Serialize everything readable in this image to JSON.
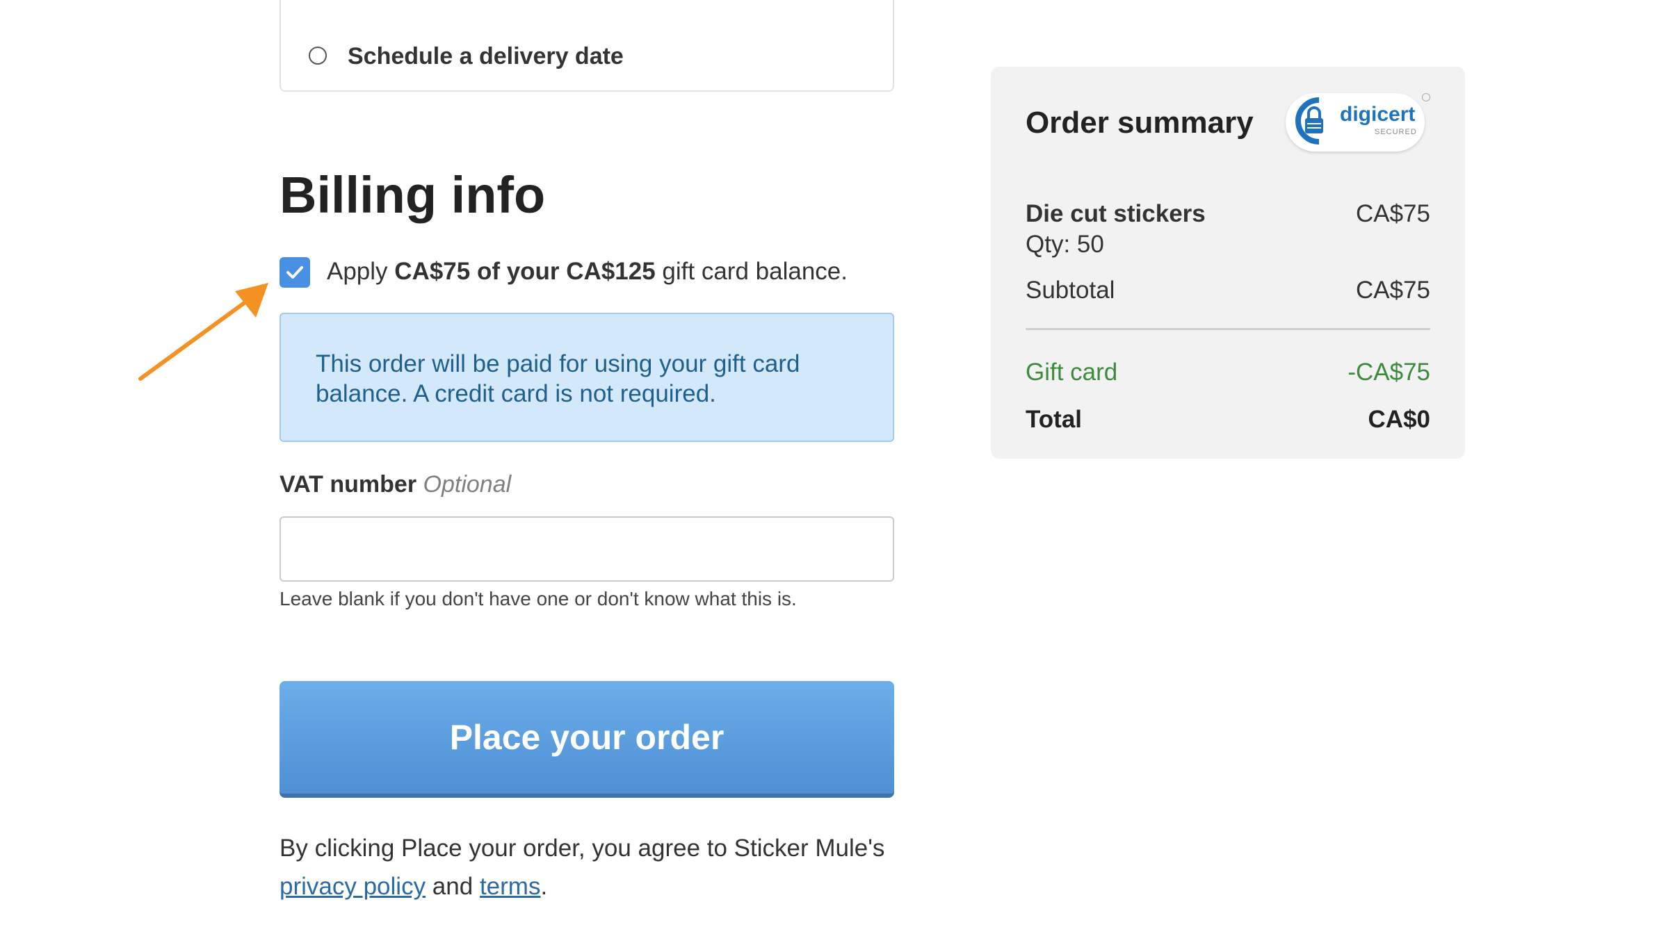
{
  "delivery": {
    "option_label": "Schedule a delivery date"
  },
  "billing": {
    "title": "Billing info",
    "gift_card": {
      "checked": true,
      "prefix": "Apply ",
      "amount_text": "CA$75 of your CA$125",
      "suffix": " gift card balance."
    },
    "notice": "This order will be paid for using your gift card balance. A credit card is not required.",
    "vat": {
      "label": "VAT number",
      "optional": "Optional",
      "value": "",
      "help": "Leave blank if you don't have one or don't know what this is."
    },
    "place_order_label": "Place your order",
    "agree": {
      "text": "By clicking Place your order, you agree to Sticker Mule's",
      "privacy_link": "privacy policy",
      "and": " and ",
      "terms_link": "terms",
      "period": "."
    }
  },
  "summary": {
    "title": "Order summary",
    "badge": {
      "brand": "digicert",
      "sub": "SECURED"
    },
    "item": {
      "name": "Die cut stickers",
      "qty": "Qty: 50",
      "price": "CA$75"
    },
    "subtotal": {
      "label": "Subtotal",
      "value": "CA$75"
    },
    "gift_card": {
      "label": "Gift card",
      "value": "-CA$75"
    },
    "total": {
      "label": "Total",
      "value": "CA$0"
    }
  },
  "colors": {
    "accent": "#4a90e2",
    "notice_bg": "#d3e9fb",
    "arrow": "#f39223",
    "discount": "#3c8a3c"
  }
}
